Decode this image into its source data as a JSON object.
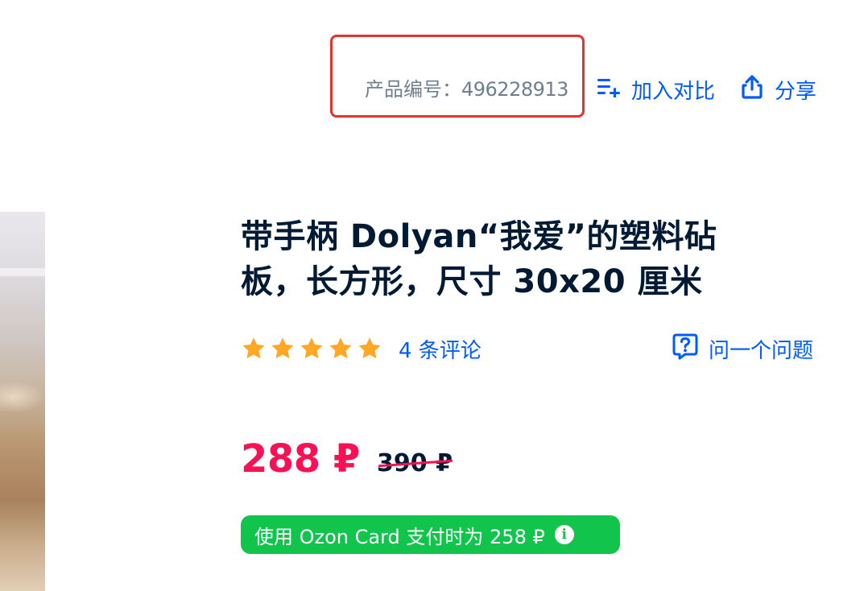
{
  "meta": {
    "sku_label": "产品编号：",
    "sku_value": "496228913",
    "compare_label": "加入对比",
    "share_label": "分享"
  },
  "product": {
    "title_line1": "带手柄 Dolyan“我爱”的塑料砧",
    "title_line2": "板，长方形，尺寸 30x20 厘米",
    "rating_stars": 5,
    "reviews_label": "4 条评论",
    "ask_label": "问一个问题"
  },
  "price": {
    "current": "288 ₽",
    "old": "390 ₽",
    "card_offer": "使用 Ozon Card 支付时为 258 ₽",
    "info_glyph": "i"
  },
  "colors": {
    "accent": "#005bff",
    "price": "#f91155",
    "card_badge": "#10c44c",
    "star": "#ffa826",
    "highlight_box": "#e8322c"
  },
  "icons": {
    "compare": "compare-list-icon",
    "share": "share-icon",
    "ask": "question-bubble-icon",
    "star": "star-icon",
    "info": "info-icon"
  }
}
